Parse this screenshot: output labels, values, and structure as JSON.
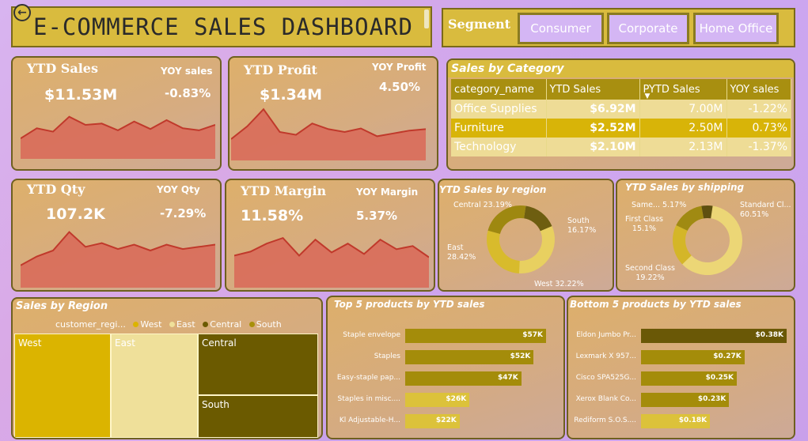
{
  "header": {
    "title": "E-COMMERCE SALES DASHBOARD"
  },
  "segment": {
    "label": "Segment",
    "options": [
      "Consumer",
      "Corporate",
      "Home Office"
    ]
  },
  "kpis": {
    "sales": {
      "label": "YTD Sales",
      "yoy_label": "YOY sales",
      "value": "$11.53M",
      "yoy": "-0.83%",
      "trend": [
        30,
        45,
        40,
        62,
        50,
        52,
        42,
        55,
        44,
        57,
        45,
        42,
        50
      ]
    },
    "profit": {
      "label": "YTD Profit",
      "yoy_label": "YOY Profit",
      "value": "$1.34M",
      "yoy": "4.50%",
      "trend": [
        30,
        48,
        72,
        40,
        36,
        52,
        44,
        40,
        45,
        34,
        38,
        42,
        44
      ]
    },
    "qty": {
      "label": "YTD Qty",
      "yoy_label": "YOY Qty",
      "value": "107.2K",
      "yoy": "-7.29%",
      "trend": [
        30,
        42,
        50,
        75,
        55,
        60,
        52,
        58,
        50,
        58,
        52,
        55,
        58
      ]
    },
    "margin": {
      "label": "YTD Margin",
      "yoy_label": "YOY Margin",
      "value": "11.58%",
      "yoy": "5.37%",
      "trend": [
        40,
        45,
        55,
        62,
        40,
        60,
        44,
        55,
        42,
        60,
        48,
        52,
        38
      ]
    }
  },
  "sales_by_category": {
    "title": "Sales by Category",
    "columns": [
      "category_name",
      "YTD Sales",
      "PYTD Sales",
      "YOY sales"
    ],
    "rows": [
      {
        "name": "Office Supplies",
        "ytd": "$6.92M",
        "pytd": "7.00M",
        "yoy": "-1.22%"
      },
      {
        "name": "Furniture",
        "ytd": "$2.52M",
        "pytd": "2.50M",
        "yoy": "0.73%"
      },
      {
        "name": "Technology",
        "ytd": "$2.10M",
        "pytd": "2.13M",
        "yoy": "-1.37%"
      }
    ]
  },
  "region_donut": {
    "title": "YTD Sales by region",
    "slices": [
      {
        "name": "South",
        "pct": "16.17%",
        "value": 16.17,
        "color": "#6e5e10"
      },
      {
        "name": "West",
        "pct": "32.22%",
        "value": 32.22,
        "color": "#e8d060"
      },
      {
        "name": "East",
        "pct": "28.42%",
        "value": 28.42,
        "color": "#d8bb2c"
      },
      {
        "name": "Central",
        "pct": "23.19%",
        "value": 23.19,
        "color": "#9e8810"
      }
    ]
  },
  "shipping_donut": {
    "title": "YTD Sales by shipping",
    "slices": [
      {
        "name": "Standard Cl...",
        "pct": "60.51%",
        "value": 60.51,
        "color": "#ecd676"
      },
      {
        "name": "Second Class",
        "pct": "19.22%",
        "value": 19.22,
        "color": "#d4b628"
      },
      {
        "name": "First Class",
        "pct": "15.1%",
        "value": 15.1,
        "color": "#a08a12"
      },
      {
        "name": "Same...",
        "pct": "5.17%",
        "value": 5.17,
        "color": "#5e5010"
      }
    ]
  },
  "sales_by_region": {
    "title": "Sales by Region",
    "legend_title": "customer_regi...",
    "legend": [
      {
        "name": "West",
        "color": "#dbb400"
      },
      {
        "name": "East",
        "color": "#efe09a"
      },
      {
        "name": "Central",
        "color": "#6b5a00"
      },
      {
        "name": "South",
        "color": "#a8900a"
      }
    ],
    "tiles": [
      "West",
      "East",
      "Central",
      "South"
    ]
  },
  "top5": {
    "title": "Top 5 products by YTD sales",
    "items": [
      {
        "name": "Staple envelope",
        "label": "$57K",
        "value": 57,
        "color": "#a48c0a"
      },
      {
        "name": "Staples",
        "label": "$52K",
        "value": 52,
        "color": "#a48c0a"
      },
      {
        "name": "Easy-staple pap...",
        "label": "$47K",
        "value": 47,
        "color": "#a48c0a"
      },
      {
        "name": "Staples in misc....",
        "label": "$26K",
        "value": 26,
        "color": "#dcc23a"
      },
      {
        "name": "Kl Adjustable-H...",
        "label": "$22K",
        "value": 22,
        "color": "#dcc23a"
      }
    ]
  },
  "bottom5": {
    "title": "Bottom 5 products by YTD sales",
    "items": [
      {
        "name": "Eldon Jumbo Pr...",
        "label": "$0.38K",
        "value": 0.38,
        "color": "#6a5806"
      },
      {
        "name": "Lexmark X 957...",
        "label": "$0.27K",
        "value": 0.27,
        "color": "#a48c0a"
      },
      {
        "name": "Cisco SPA525G...",
        "label": "$0.25K",
        "value": 0.25,
        "color": "#a48c0a"
      },
      {
        "name": "Xerox Blank Co...",
        "label": "$0.23K",
        "value": 0.23,
        "color": "#a48c0a"
      },
      {
        "name": "Rediform S.O.S....",
        "label": "$0.18K",
        "value": 0.18,
        "color": "#dcc23a"
      }
    ]
  }
}
